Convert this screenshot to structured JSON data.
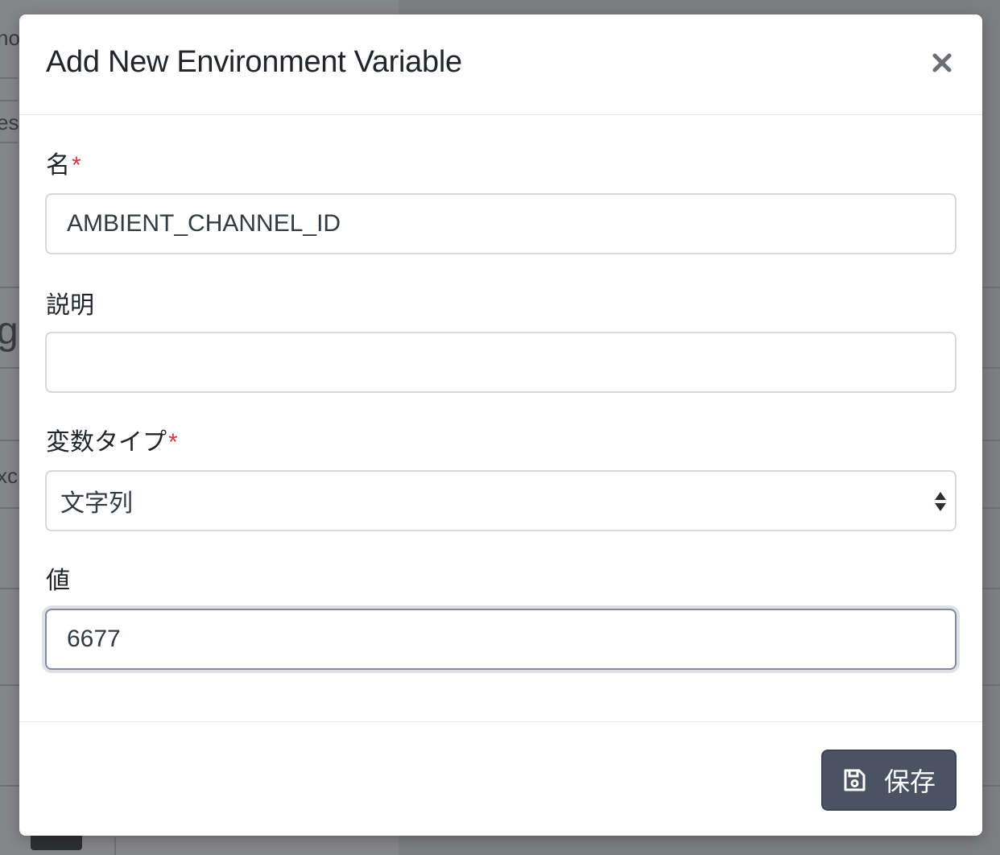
{
  "background": {
    "fragments": [
      "no",
      "est",
      "g",
      "xc"
    ]
  },
  "modal": {
    "title": "Add New Environment Variable",
    "close_icon": "close-icon"
  },
  "form": {
    "name": {
      "label": "名",
      "required_mark": "*",
      "value": "AMBIENT_CHANNEL_ID"
    },
    "description": {
      "label": "説明",
      "value": ""
    },
    "type": {
      "label": "変数タイプ",
      "required_mark": "*",
      "selected": "文字列"
    },
    "value": {
      "label": "値",
      "value": "6677"
    }
  },
  "footer": {
    "save_label": "保存",
    "save_icon": "floppy-disk-icon"
  },
  "colors": {
    "required": "#dc3545",
    "save_button": "#4b5363",
    "focus_border": "#838aa3"
  }
}
